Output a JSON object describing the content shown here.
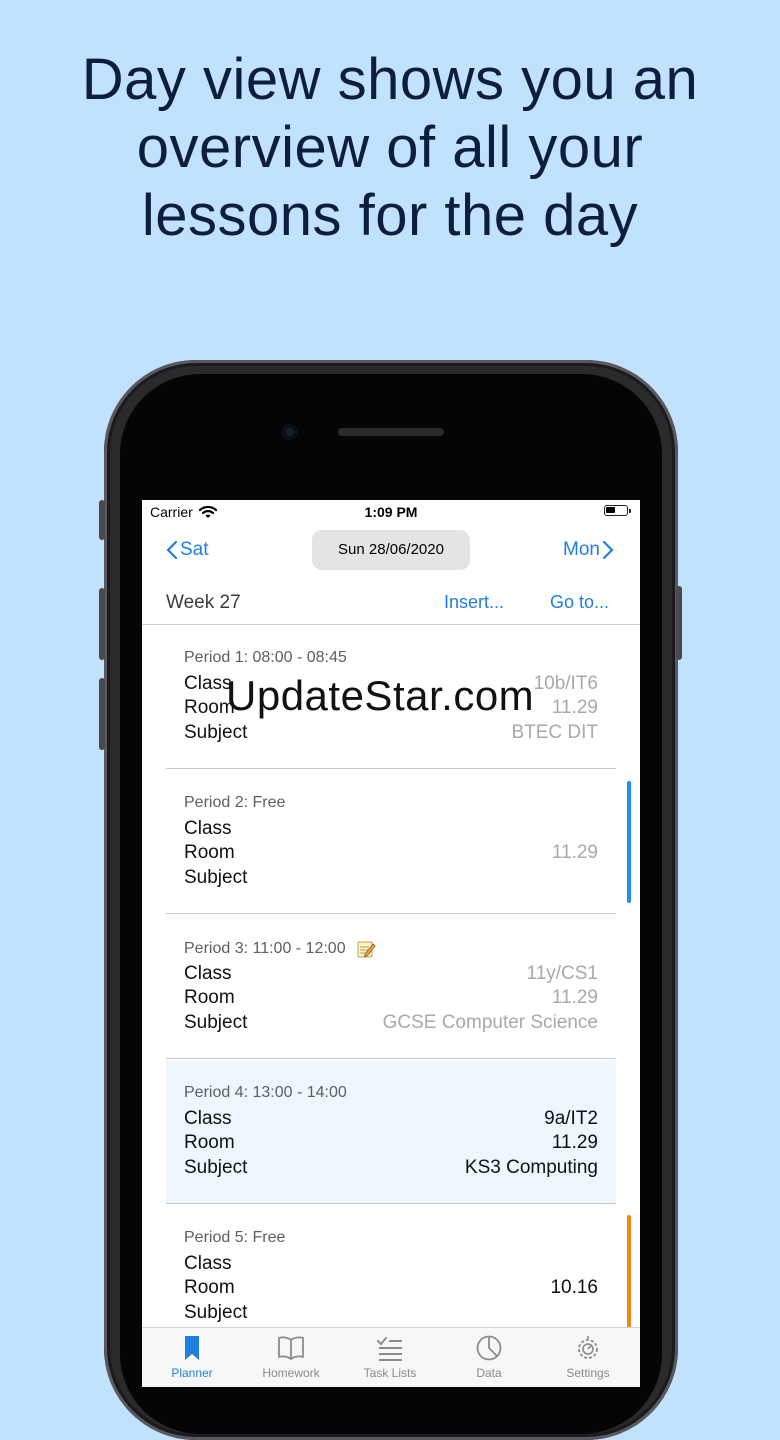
{
  "headline": {
    "line1": "Day view shows you an",
    "line2": "overview of all your",
    "line3": "lessons for the day"
  },
  "status_bar": {
    "carrier": "Carrier",
    "time": "1:09 PM"
  },
  "nav": {
    "prev_label": "Sat",
    "date": "Sun 28/06/2020",
    "next_label": "Mon"
  },
  "subbar": {
    "week": "Week 27",
    "insert": "Insert...",
    "goto": "Go to..."
  },
  "row_labels": {
    "class": "Class",
    "room": "Room",
    "subject": "Subject"
  },
  "periods": [
    {
      "title": "Period 1: 08:00 - 08:45",
      "class": "10b/IT6",
      "room": "11.29",
      "subject": "BTEC DIT"
    },
    {
      "title": "Period 2: Free",
      "class": "",
      "room": "11.29",
      "subject": ""
    },
    {
      "title": "Period 3: 11:00 - 12:00",
      "class": "11y/CS1",
      "room": "11.29",
      "subject": "GCSE Computer Science"
    },
    {
      "title": "Period 4: 13:00 - 14:00",
      "class": "9a/IT2",
      "room": "11.29",
      "subject": "KS3 Computing"
    },
    {
      "title": "Period 5: Free",
      "class": "",
      "room": "10.16",
      "subject": ""
    }
  ],
  "tabs": [
    {
      "label": "Planner",
      "icon": "bookmark-icon"
    },
    {
      "label": "Homework",
      "icon": "book-icon"
    },
    {
      "label": "Task Lists",
      "icon": "checklist-icon"
    },
    {
      "label": "Data",
      "icon": "pie-chart-icon"
    },
    {
      "label": "Settings",
      "icon": "gear-icon"
    }
  ],
  "watermark": "UpdateStar.com",
  "colors": {
    "background": "#c0e2fd",
    "accent": "#1e80de",
    "indicator_blue": "#1e8ef0",
    "indicator_orange": "#ef8a10",
    "active_card": "#eef7ff"
  }
}
